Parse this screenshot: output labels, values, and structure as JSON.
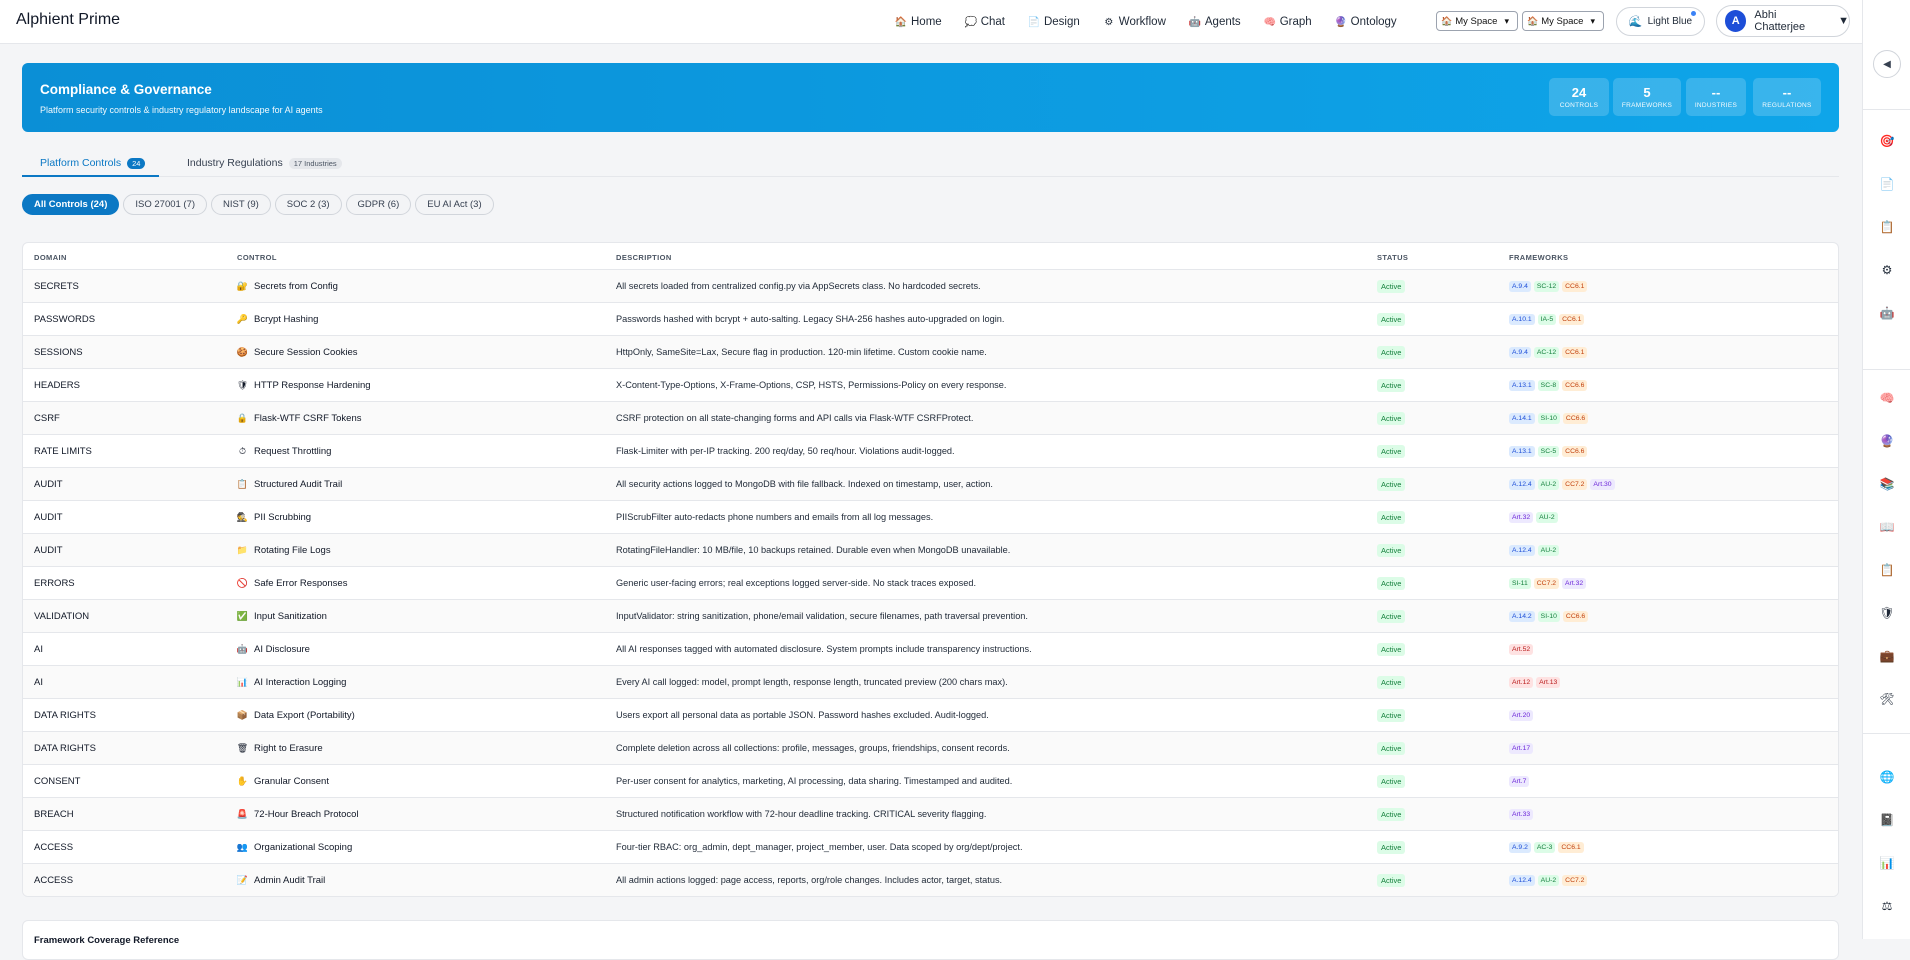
{
  "app": {
    "title": "Alphient Prime"
  },
  "nav": [
    {
      "label": "Home",
      "icon": "house-icon"
    },
    {
      "label": "Chat",
      "icon": "chat-icon"
    },
    {
      "label": "Design",
      "icon": "document-icon"
    },
    {
      "label": "Workflow",
      "icon": "gear-icon"
    },
    {
      "label": "Agents",
      "icon": "robot-icon"
    },
    {
      "label": "Graph",
      "icon": "brain-icon"
    },
    {
      "label": "Ontology",
      "icon": "ontology-icon"
    }
  ],
  "selectors": {
    "space1": "My Space",
    "space2": "My Space"
  },
  "theme": {
    "label": "Light Blue"
  },
  "user": {
    "initial": "A",
    "name": "Abhi Chatterjee"
  },
  "hero": {
    "title": "Compliance & Governance",
    "subtitle": "Platform security controls & industry regulatory landscape for AI agents",
    "stats": [
      {
        "value": "24",
        "label": "CONTROLS"
      },
      {
        "value": "5",
        "label": "FRAMEWORKS"
      },
      {
        "value": "--",
        "label": "INDUSTRIES"
      },
      {
        "value": "--",
        "label": "REGULATIONS"
      }
    ]
  },
  "tabs": [
    {
      "label": "Platform Controls",
      "badge": "24",
      "active": true
    },
    {
      "label": "Industry Regulations",
      "badge": "17 Industries",
      "active": false
    }
  ],
  "filters": [
    {
      "label": "All Controls (24)",
      "active": true
    },
    {
      "label": "ISO 27001 (7)",
      "active": false
    },
    {
      "label": "NIST (9)",
      "active": false
    },
    {
      "label": "SOC 2 (3)",
      "active": false
    },
    {
      "label": "GDPR (6)",
      "active": false
    },
    {
      "label": "EU AI Act (3)",
      "active": false
    }
  ],
  "table": {
    "headers": {
      "domain": "DOMAIN",
      "control": "CONTROL",
      "description": "DESCRIPTION",
      "status": "STATUS",
      "frameworks": "FRAMEWORKS"
    },
    "rows": [
      {
        "domain": "SECRETS",
        "icon": "🔐",
        "control": "Secrets from Config",
        "description": "All secrets loaded from centralized config.py via AppSecrets class. No hardcoded secrets.",
        "status": "Active",
        "frameworks": [
          [
            "A.9.4",
            "iso"
          ],
          [
            "SC-12",
            "nist"
          ],
          [
            "CC6.1",
            "soc"
          ]
        ]
      },
      {
        "domain": "PASSWORDS",
        "icon": "🔑",
        "control": "Bcrypt Hashing",
        "description": "Passwords hashed with bcrypt + auto-salting. Legacy SHA-256 hashes auto-upgraded on login.",
        "status": "Active",
        "frameworks": [
          [
            "A.10.1",
            "iso"
          ],
          [
            "IA-5",
            "nist"
          ],
          [
            "CC6.1",
            "soc"
          ]
        ]
      },
      {
        "domain": "SESSIONS",
        "icon": "🍪",
        "control": "Secure Session Cookies",
        "description": "HttpOnly, SameSite=Lax, Secure flag in production. 120-min lifetime. Custom cookie name.",
        "status": "Active",
        "frameworks": [
          [
            "A.9.4",
            "iso"
          ],
          [
            "AC-12",
            "nist"
          ],
          [
            "CC6.1",
            "soc"
          ]
        ]
      },
      {
        "domain": "HEADERS",
        "icon": "🛡",
        "control": "HTTP Response Hardening",
        "description": "X-Content-Type-Options, X-Frame-Options, CSP, HSTS, Permissions-Policy on every response.",
        "status": "Active",
        "frameworks": [
          [
            "A.13.1",
            "iso"
          ],
          [
            "SC-8",
            "nist"
          ],
          [
            "CC6.6",
            "soc"
          ]
        ]
      },
      {
        "domain": "CSRF",
        "icon": "🔒",
        "control": "Flask-WTF CSRF Tokens",
        "description": "CSRF protection on all state-changing forms and API calls via Flask-WTF CSRFProtect.",
        "status": "Active",
        "frameworks": [
          [
            "A.14.1",
            "iso"
          ],
          [
            "SI-10",
            "nist"
          ],
          [
            "CC6.6",
            "soc"
          ]
        ]
      },
      {
        "domain": "RATE LIMITS",
        "icon": "⏱",
        "control": "Request Throttling",
        "description": "Flask-Limiter with per-IP tracking. 200 req/day, 50 req/hour. Violations audit-logged.",
        "status": "Active",
        "frameworks": [
          [
            "A.13.1",
            "iso"
          ],
          [
            "SC-5",
            "nist"
          ],
          [
            "CC6.6",
            "soc"
          ]
        ]
      },
      {
        "domain": "AUDIT",
        "icon": "📋",
        "control": "Structured Audit Trail",
        "description": "All security actions logged to MongoDB with file fallback. Indexed on timestamp, user, action.",
        "status": "Active",
        "frameworks": [
          [
            "A.12.4",
            "iso"
          ],
          [
            "AU-2",
            "nist"
          ],
          [
            "CC7.2",
            "soc"
          ],
          [
            "Art.30",
            "gdpr"
          ]
        ]
      },
      {
        "domain": "AUDIT",
        "icon": "🕵",
        "control": "PII Scrubbing",
        "description": "PIIScrubFilter auto-redacts phone numbers and emails from all log messages.",
        "status": "Active",
        "frameworks": [
          [
            "Art.32",
            "gdpr"
          ],
          [
            "AU-2",
            "nist"
          ]
        ]
      },
      {
        "domain": "AUDIT",
        "icon": "📁",
        "control": "Rotating File Logs",
        "description": "RotatingFileHandler: 10 MB/file, 10 backups retained. Durable even when MongoDB unavailable.",
        "status": "Active",
        "frameworks": [
          [
            "A.12.4",
            "iso"
          ],
          [
            "AU-2",
            "nist"
          ]
        ]
      },
      {
        "domain": "ERRORS",
        "icon": "🚫",
        "control": "Safe Error Responses",
        "description": "Generic user-facing errors; real exceptions logged server-side. No stack traces exposed.",
        "status": "Active",
        "frameworks": [
          [
            "SI-11",
            "nist"
          ],
          [
            "CC7.2",
            "soc"
          ],
          [
            "Art.32",
            "gdpr"
          ]
        ]
      },
      {
        "domain": "VALIDATION",
        "icon": "✅",
        "control": "Input Sanitization",
        "description": "InputValidator: string sanitization, phone/email validation, secure filenames, path traversal prevention.",
        "status": "Active",
        "frameworks": [
          [
            "A.14.2",
            "iso"
          ],
          [
            "SI-10",
            "nist"
          ],
          [
            "CC6.6",
            "soc"
          ]
        ]
      },
      {
        "domain": "AI",
        "icon": "🤖",
        "control": "AI Disclosure",
        "description": "All AI responses tagged with automated disclosure. System prompts include transparency instructions.",
        "status": "Active",
        "frameworks": [
          [
            "Art.52",
            "ai"
          ]
        ]
      },
      {
        "domain": "AI",
        "icon": "📊",
        "control": "AI Interaction Logging",
        "description": "Every AI call logged: model, prompt length, response length, truncated preview (200 chars max).",
        "status": "Active",
        "frameworks": [
          [
            "Art.12",
            "ai"
          ],
          [
            "Art.13",
            "ai"
          ]
        ]
      },
      {
        "domain": "DATA RIGHTS",
        "icon": "📦",
        "control": "Data Export (Portability)",
        "description": "Users export all personal data as portable JSON. Password hashes excluded. Audit-logged.",
        "status": "Active",
        "frameworks": [
          [
            "Art.20",
            "gdpr"
          ]
        ]
      },
      {
        "domain": "DATA RIGHTS",
        "icon": "🗑",
        "control": "Right to Erasure",
        "description": "Complete deletion across all collections: profile, messages, groups, friendships, consent records.",
        "status": "Active",
        "frameworks": [
          [
            "Art.17",
            "gdpr"
          ]
        ]
      },
      {
        "domain": "CONSENT",
        "icon": "✋",
        "control": "Granular Consent",
        "description": "Per-user consent for analytics, marketing, AI processing, data sharing. Timestamped and audited.",
        "status": "Active",
        "frameworks": [
          [
            "Art.7",
            "gdpr"
          ]
        ]
      },
      {
        "domain": "BREACH",
        "icon": "🚨",
        "control": "72-Hour Breach Protocol",
        "description": "Structured notification workflow with 72-hour deadline tracking. CRITICAL severity flagging.",
        "status": "Active",
        "frameworks": [
          [
            "Art.33",
            "gdpr"
          ]
        ]
      },
      {
        "domain": "ACCESS",
        "icon": "👥",
        "control": "Organizational Scoping",
        "description": "Four-tier RBAC: org_admin, dept_manager, project_member, user. Data scoped by org/dept/project.",
        "status": "Active",
        "frameworks": [
          [
            "A.9.2",
            "iso"
          ],
          [
            "AC-3",
            "nist"
          ],
          [
            "CC6.1",
            "soc"
          ]
        ]
      },
      {
        "domain": "ACCESS",
        "icon": "📝",
        "control": "Admin Audit Trail",
        "description": "All admin actions logged: page access, reports, org/role changes. Includes actor, target, status.",
        "status": "Active",
        "frameworks": [
          [
            "A.12.4",
            "iso"
          ],
          [
            "AU-2",
            "nist"
          ],
          [
            "CC7.2",
            "soc"
          ]
        ]
      }
    ]
  },
  "reference": {
    "title": "Framework Coverage Reference"
  },
  "rail": {
    "toggle": "◀",
    "icons": [
      [
        "target-icon",
        "🎯"
      ],
      [
        "document-icon",
        "📄"
      ],
      [
        "clipboard-icon",
        "📋"
      ],
      [
        "gear-icon",
        "⚙"
      ],
      [
        "robot-icon",
        "🤖"
      ],
      [
        "brain-icon",
        "🧠"
      ],
      [
        "ontology-icon",
        "🔮"
      ],
      [
        "books-icon",
        "📚"
      ],
      [
        "book-icon",
        "📖"
      ],
      [
        "clipboard2-icon",
        "📋"
      ],
      [
        "shield-icon",
        "🛡"
      ],
      [
        "briefcase-icon",
        "💼"
      ],
      [
        "tools-icon",
        "🛠"
      ],
      [
        "globe-icon",
        "🌐"
      ],
      [
        "notebook-icon",
        "📓"
      ],
      [
        "chart-icon",
        "📊"
      ],
      [
        "scales-icon",
        "⚖"
      ]
    ]
  }
}
